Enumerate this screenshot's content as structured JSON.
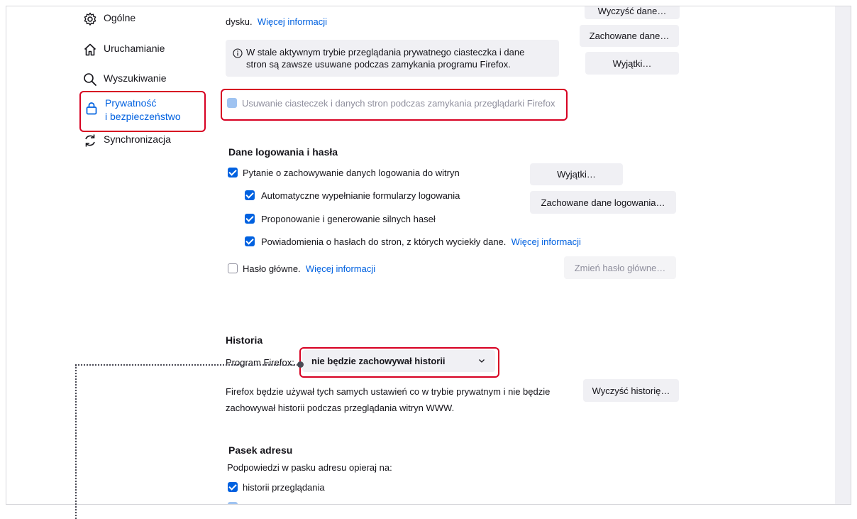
{
  "sidebar": {
    "items": [
      {
        "label": "Ogólne",
        "icon": "gear-icon"
      },
      {
        "label": "Uruchamianie",
        "icon": "home-icon"
      },
      {
        "label": "Wyszukiwanie",
        "icon": "search-icon"
      },
      {
        "label_line1": "Prywatność",
        "label_line2": "i bezpieczeństwo",
        "icon": "lock-icon",
        "active": true
      },
      {
        "label": "Synchronizacja",
        "icon": "sync-icon"
      }
    ]
  },
  "cookies": {
    "disk_text": "dysku.",
    "more_info": "Więcej informacji",
    "info_text_line1": "W stale aktywnym trybie przeglądania prywatnego ciasteczka i dane",
    "info_text_line2": "stron są zawsze usuwane podczas zamykania programu Firefox.",
    "delete_on_close": "Usuwanie ciasteczek i danych stron podczas zamykania przeglądarki Firefox",
    "buttons": {
      "clear_data": "Wyczyść dane…",
      "saved_data": "Zachowane dane…",
      "exceptions": "Wyjątki…"
    }
  },
  "logins": {
    "title": "Dane logowania i hasła",
    "ask_save": "Pytanie o zachowywanie danych logowania do witryn",
    "autofill": "Automatyczne wypełnianie formularzy logowania",
    "suggest_strong": "Proponowanie i generowanie silnych haseł",
    "breach_alerts": "Powiadomienia o hasłach do stron, z których wyciekły dane.",
    "breach_more_info": "Więcej informacji",
    "master_password": "Hasło główne.",
    "master_more_info": "Więcej informacji",
    "buttons": {
      "exceptions": "Wyjątki…",
      "saved_logins": "Zachowane dane logowania…",
      "change_master": "Zmień hasło główne…"
    }
  },
  "history": {
    "title": "Historia",
    "program_label": "Program Firefox:",
    "select_value": "nie będzie zachowywał historii",
    "desc_line1": "Firefox będzie używał tych samych ustawień co w trybie prywatnym i nie będzie",
    "desc_line2": "zachowywał historii podczas przeglądania witryn WWW.",
    "clear_button": "Wyczyść historię…"
  },
  "addressbar": {
    "title": "Pasek adresu",
    "subtitle": "Podpowiedzi w pasku adresu opieraj na:",
    "browsing_history": "historii przeglądania"
  },
  "colors": {
    "accent": "#0061e0",
    "highlight": "#d70022"
  }
}
